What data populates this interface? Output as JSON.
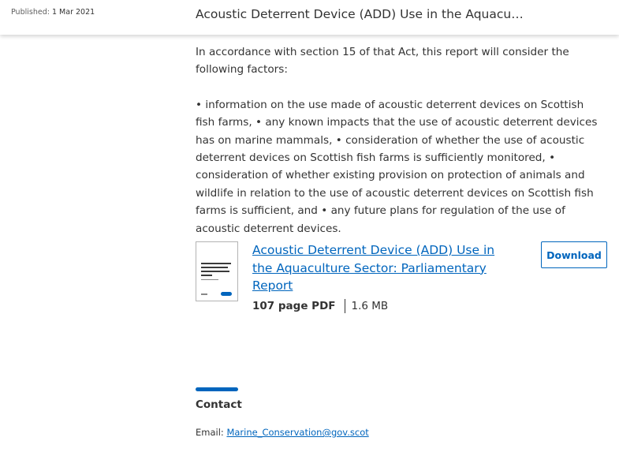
{
  "header": {
    "published_label": "Published:",
    "published_date": "1 Mar 2021",
    "title": "Acoustic Deterrent Device (ADD) Use in the Aquaculture …"
  },
  "body": {
    "intro": "In accordance with section 15 of that Act, this report will consider the following factors:",
    "factors": "• information on the use made of acoustic deterrent devices on Scottish fish farms, • any known impacts that the use of acoustic deterrent devices has on marine mammals, • consideration of whether the use of acoustic deterrent devices on Scottish fish farms is sufficiently monitored, • consideration of whether existing provision on protection of animals and wildlife in relation to the use of acoustic deterrent devices on Scottish fish farms is sufficient, and • any future plans for regulation of the use of acoustic deterrent devices."
  },
  "document": {
    "link_text": "Acoustic Deterrent Device (ADD) Use in the Aquaculture Sector: Parliamentary Report",
    "file_type": "107 page PDF",
    "file_size": "1.6 MB",
    "download_label": "Download",
    "thumbnail_icon": "document-thumbnail"
  },
  "contact": {
    "heading": "Contact",
    "email_label": "Email:",
    "email": "Marine_Conservation@gov.scot"
  },
  "colors": {
    "accent": "#0065bd",
    "text": "#333333"
  }
}
